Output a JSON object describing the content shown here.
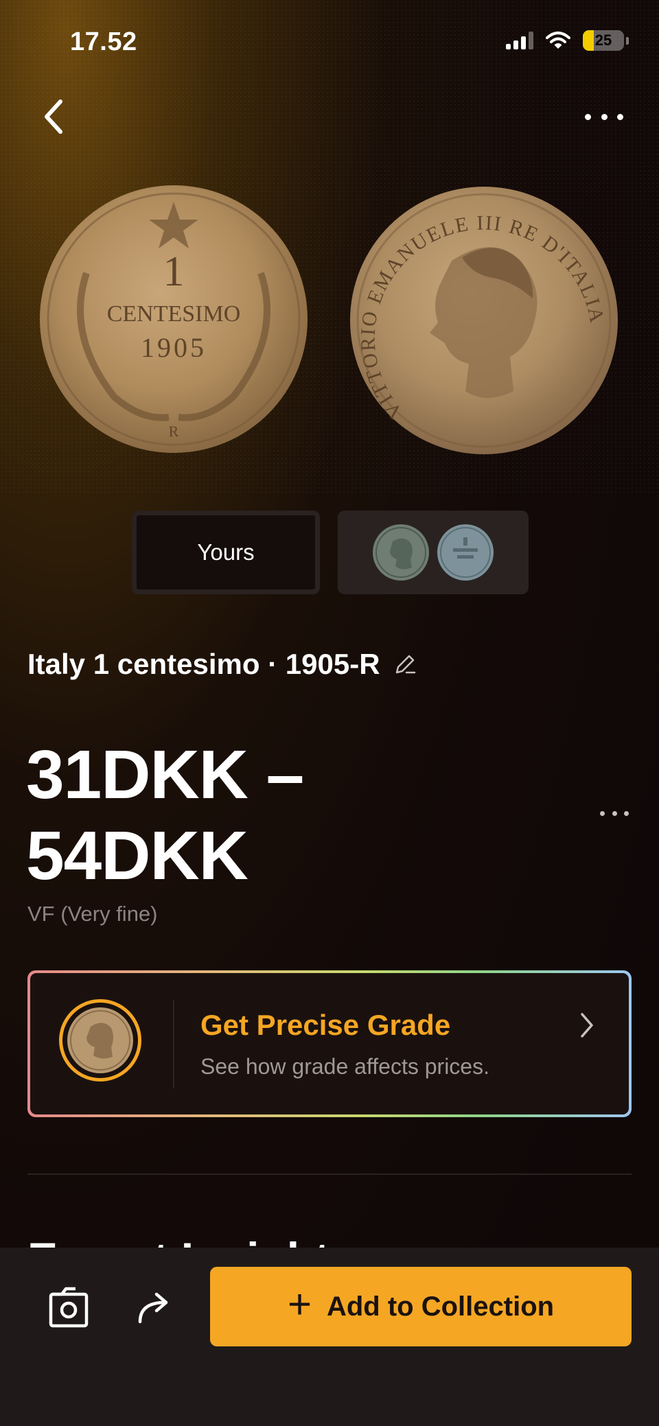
{
  "status_bar": {
    "time": "17.52",
    "battery": "25"
  },
  "header": {
    "back_icon": "chevron-left-icon",
    "more_icon": "more-horizontal-icon"
  },
  "coin_images": {
    "reverse": {
      "value_numeral": "1",
      "denomination": "CENTESIMO",
      "year": "1905",
      "mint_mark": "R"
    },
    "obverse": {
      "legend": "VITTORIO EMANUELE III RE D'ITALIA"
    }
  },
  "photo_tabs": [
    {
      "label": "Yours",
      "selected": true
    },
    {
      "label": "",
      "kind": "reference-coin-thumbnails"
    }
  ],
  "coin": {
    "title": "Italy 1 centesimo · 1905-R",
    "price_range": "31DKK – 54DKK",
    "grade": "VF (Very fine)"
  },
  "grade_card": {
    "title": "Get Precise Grade",
    "subtitle": "See how grade affects prices."
  },
  "section": {
    "title": "Expert Insights"
  },
  "bottom_bar": {
    "add_label": "Add to Collection",
    "camera_icon": "photo-camera-icon",
    "share_icon": "share-arrow-icon"
  },
  "colors": {
    "accent": "#f5a623",
    "background": "#120908",
    "bottom_bar": "#1f1a19",
    "muted_text": "#8c8482"
  }
}
